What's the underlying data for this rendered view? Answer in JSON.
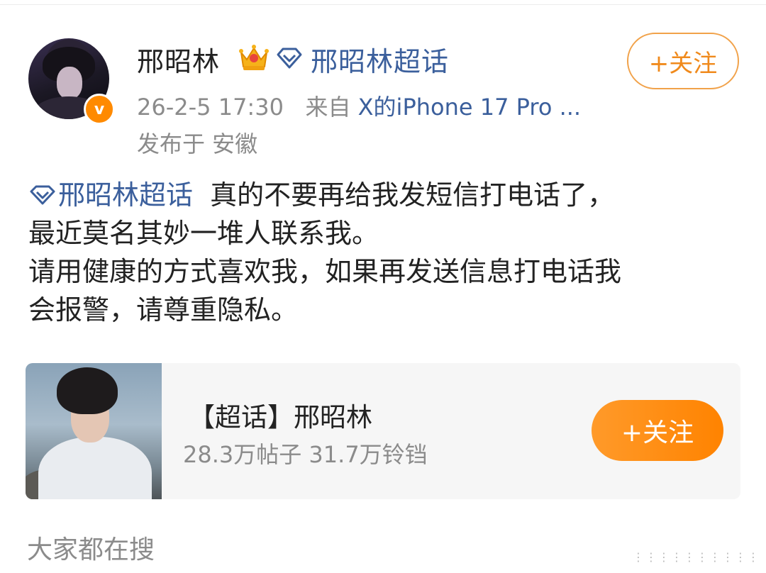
{
  "user": {
    "name": "邢昭林",
    "badge_icon": "crown-icon",
    "verified_icon": "verified-v-icon",
    "verified_color": "#ff8a00",
    "supertopic_link": "邢昭林超话",
    "follow_label": "+关注"
  },
  "meta": {
    "timestamp": "26-2-5 17:30",
    "from_label": "来自",
    "source": "X的iPhone 17 Pro ...",
    "location": "发布于 安徽"
  },
  "post": {
    "tag": "邢昭林超话",
    "line1_rest": "  真的不要再给我发短信打电话了，",
    "line2": "最近莫名其妙一堆人联系我。",
    "line3": "请用健康的方式喜欢我，如果再发送信息打电话我",
    "line4": "会报警，请尊重隐私。"
  },
  "card": {
    "title": "【超话】邢昭林",
    "stats": "28.3万帖子 31.7万铃铛",
    "follow_label": "+关注"
  },
  "footer": {
    "everyone_search": "大家都在搜"
  },
  "colors": {
    "link_blue": "#3b5f9c",
    "accent_orange": "#ff8300",
    "muted_gray": "#8b8b8b"
  }
}
